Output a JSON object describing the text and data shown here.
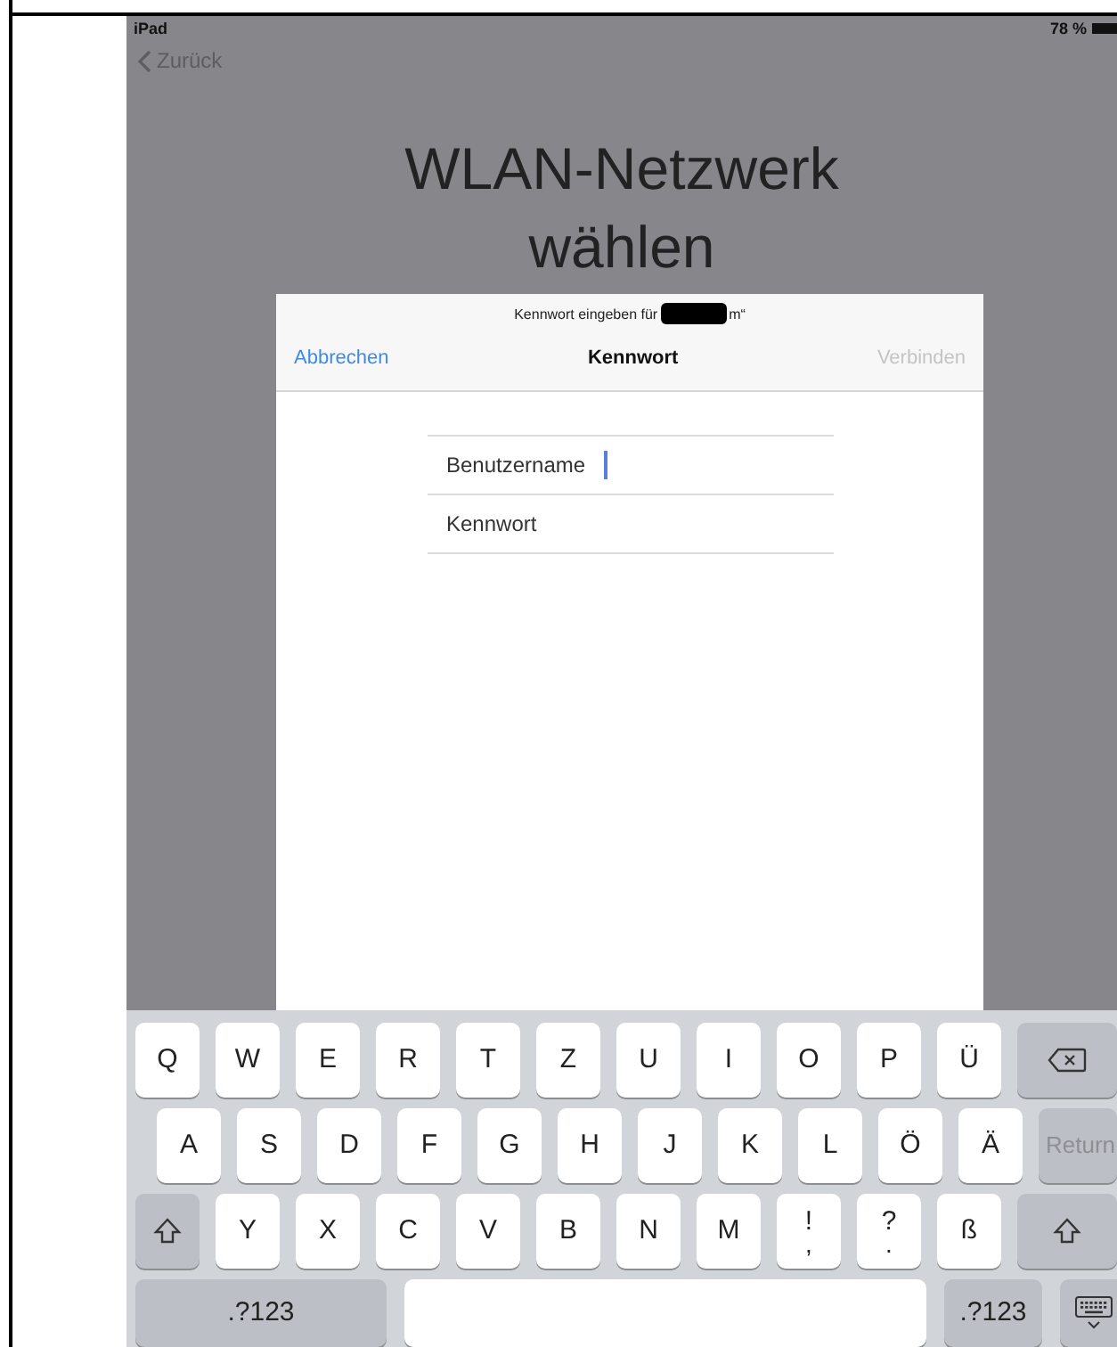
{
  "status_bar": {
    "device": "iPad",
    "battery": "78 %"
  },
  "back_button": {
    "label": "Zurück"
  },
  "title": [
    "WLAN-Netzwerk",
    "wählen"
  ],
  "dialog": {
    "prompt_prefix": "Kennwort eingeben für",
    "prompt_suffix": "m“",
    "redacted": true,
    "cancel": {
      "label": "Abbrechen",
      "disabled": false
    },
    "heading": "Kennwort",
    "connect": {
      "label": "Verbinden",
      "disabled": true
    },
    "fields": [
      {
        "placeholder": "Benutzername",
        "focused": true
      },
      {
        "placeholder": "Kennwort",
        "focused": false
      }
    ]
  },
  "keyboard": {
    "rows": [
      {
        "keys": [
          {
            "kind": "letter",
            "label": "Q"
          },
          {
            "kind": "letter",
            "label": "W"
          },
          {
            "kind": "letter",
            "label": "E"
          },
          {
            "kind": "letter",
            "label": "R"
          },
          {
            "kind": "letter",
            "label": "T"
          },
          {
            "kind": "letter",
            "label": "Z"
          },
          {
            "kind": "letter",
            "label": "U"
          },
          {
            "kind": "letter",
            "label": "I"
          },
          {
            "kind": "letter",
            "label": "O"
          },
          {
            "kind": "letter",
            "label": "P"
          },
          {
            "kind": "letter",
            "label": "Ü"
          },
          {
            "kind": "delete"
          }
        ]
      },
      {
        "keys": [
          {
            "kind": "letter",
            "label": "A"
          },
          {
            "kind": "letter",
            "label": "S"
          },
          {
            "kind": "letter",
            "label": "D"
          },
          {
            "kind": "letter",
            "label": "F"
          },
          {
            "kind": "letter",
            "label": "G"
          },
          {
            "kind": "letter",
            "label": "H"
          },
          {
            "kind": "letter",
            "label": "J"
          },
          {
            "kind": "letter",
            "label": "K"
          },
          {
            "kind": "letter",
            "label": "L"
          },
          {
            "kind": "letter",
            "label": "Ö"
          },
          {
            "kind": "letter",
            "label": "Ä"
          },
          {
            "kind": "return",
            "label": "Return",
            "disabled": true
          }
        ]
      },
      {
        "keys": [
          {
            "kind": "shift"
          },
          {
            "kind": "letter",
            "label": "Y"
          },
          {
            "kind": "letter",
            "label": "X"
          },
          {
            "kind": "letter",
            "label": "C"
          },
          {
            "kind": "letter",
            "label": "V"
          },
          {
            "kind": "letter",
            "label": "B"
          },
          {
            "kind": "letter",
            "label": "N"
          },
          {
            "kind": "letter",
            "label": "M"
          },
          {
            "kind": "letter",
            "label": "!",
            "sublabel": ","
          },
          {
            "kind": "letter",
            "label": "?",
            "sublabel": "."
          },
          {
            "kind": "letter",
            "label": "ß"
          },
          {
            "kind": "shift"
          }
        ]
      }
    ],
    "bottom_bar": {
      "keys": [
        {
          "kind": "mode",
          "label": ".?123"
        },
        {
          "kind": "space"
        },
        {
          "kind": "mode",
          "label": ".?123"
        },
        {
          "kind": "dismiss"
        }
      ]
    }
  }
}
